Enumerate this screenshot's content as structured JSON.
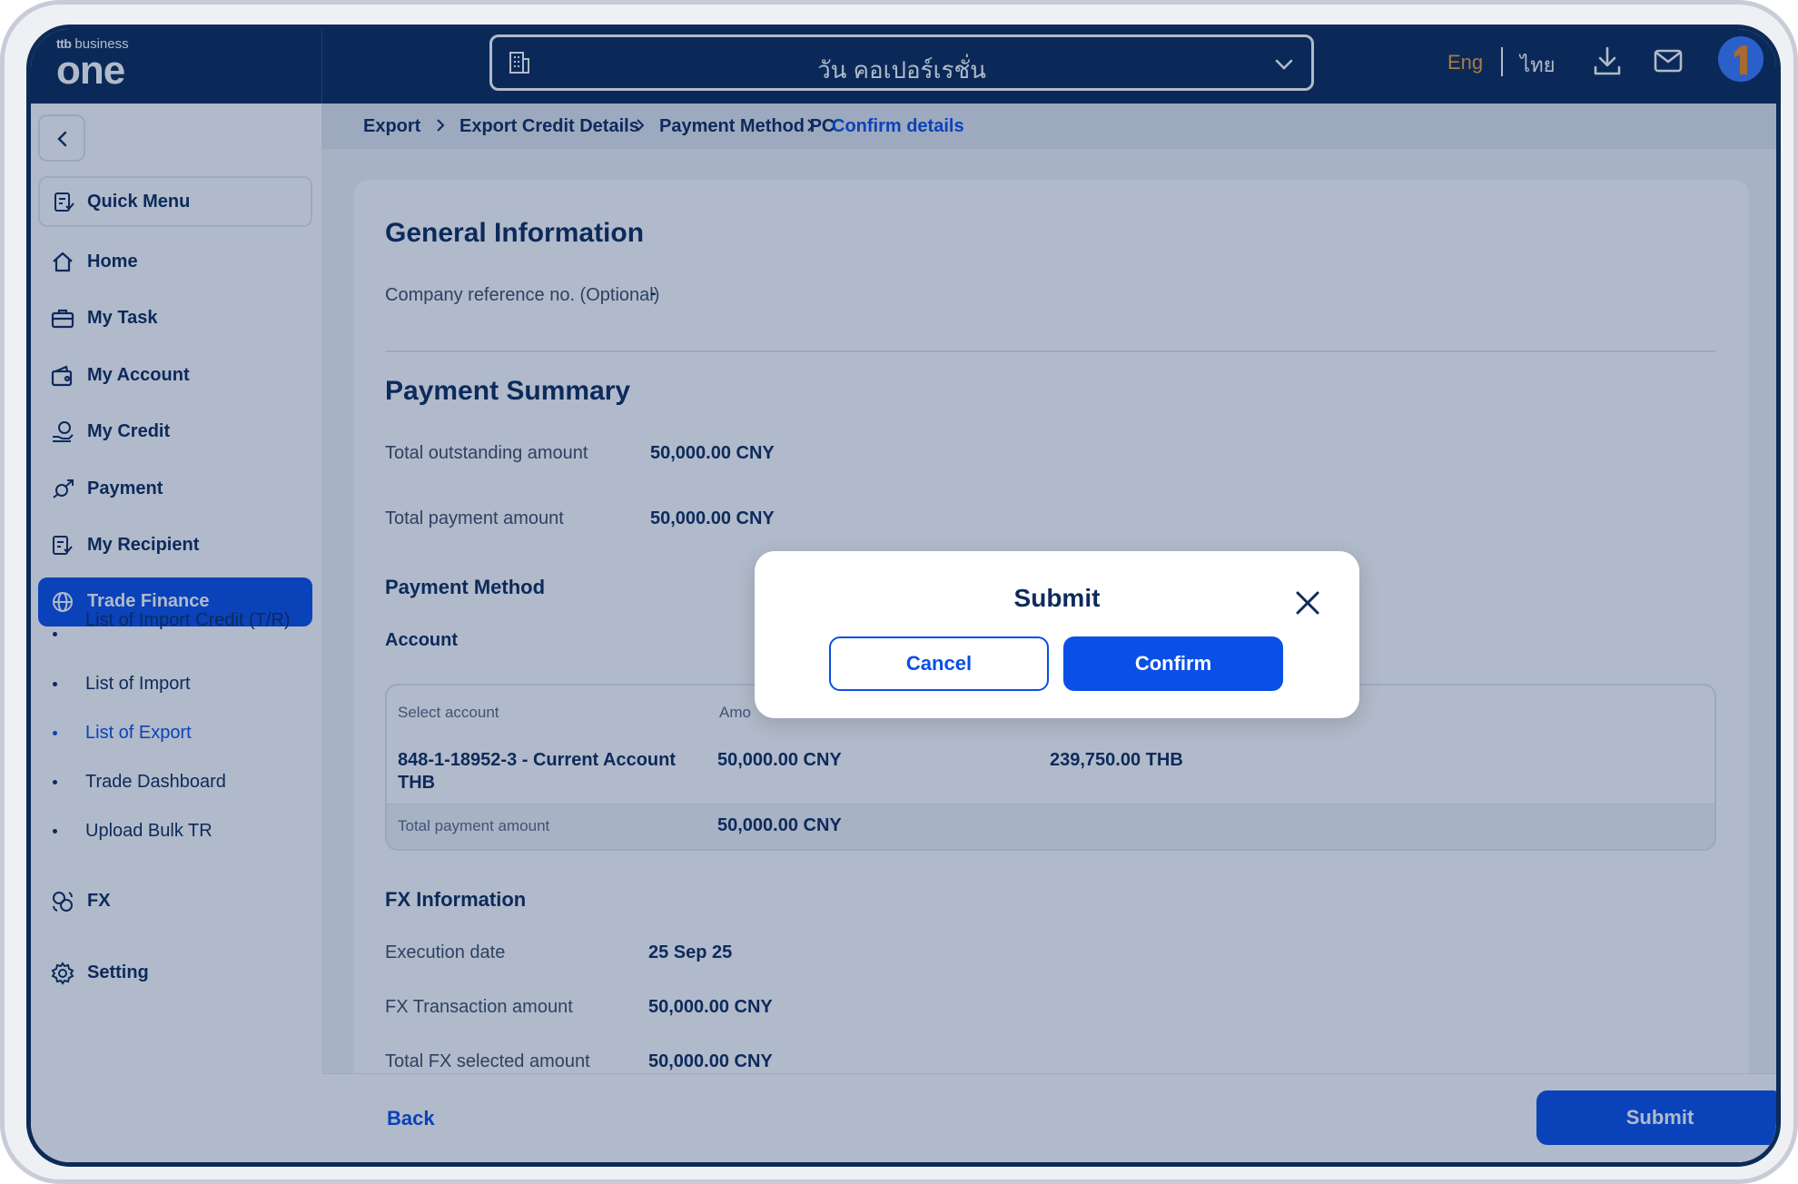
{
  "brand": {
    "prefix": "ttb",
    "suffix": "business",
    "wordmark": "one"
  },
  "header": {
    "company_name": "วัน คอเปอร์เรชั่น",
    "lang_eng": "Eng",
    "lang_th": "ไทย",
    "accent_color": "#f4a23c"
  },
  "sidebar": {
    "quick_menu": "Quick Menu",
    "items": [
      {
        "label": "Home",
        "icon": "home-icon"
      },
      {
        "label": "My Task",
        "icon": "briefcase-icon"
      },
      {
        "label": "My Account",
        "icon": "wallet-icon"
      },
      {
        "label": "My Credit",
        "icon": "credit-icon"
      },
      {
        "label": "Payment",
        "icon": "payment-icon"
      },
      {
        "label": "My Recipient",
        "icon": "recipient-icon"
      },
      {
        "label": "Trade Finance",
        "icon": "globe-icon",
        "active": true
      }
    ],
    "sub_items": [
      {
        "label": "List of Import Credit (T/R)"
      },
      {
        "label": "List of Import"
      },
      {
        "label": "List of Export",
        "current": true
      },
      {
        "label": "Trade Dashboard"
      },
      {
        "label": "Upload Bulk TR"
      }
    ],
    "bottom_items": [
      {
        "label": "FX",
        "icon": "fx-icon"
      },
      {
        "label": "Setting",
        "icon": "gear-icon"
      }
    ]
  },
  "breadcrumb": [
    "Export",
    "Export Credit Details",
    "Payment Method PC",
    "Confirm details"
  ],
  "general": {
    "title": "General Information",
    "ref_label": "Company reference no. (Optional)",
    "ref_value": "-"
  },
  "summary": {
    "title": "Payment Summary",
    "outstanding_label": "Total outstanding amount",
    "outstanding_value": "50,000.00 CNY",
    "payment_label": "Total payment amount",
    "payment_value": "50,000.00 CNY"
  },
  "method": {
    "title": "Payment Method",
    "account_title": "Account",
    "table": {
      "col_account": "Select account",
      "col_amount": "Amo",
      "row_account": "848-1-18952-3 - Current Account THB",
      "row_amount": "50,000.00 CNY",
      "row_thb": "239,750.00 THB",
      "total_label": "Total payment amount",
      "total_value": "50,000.00 CNY"
    }
  },
  "fx": {
    "title": "FX Information",
    "exec_label": "Execution date",
    "exec_value": "25 Sep 25",
    "txn_label": "FX Transaction amount",
    "txn_value": "50,000.00 CNY",
    "selected_label": "Total FX selected amount",
    "selected_value": "50,000.00 CNY"
  },
  "footer": {
    "back": "Back",
    "submit": "Submit"
  },
  "modal": {
    "title": "Submit",
    "cancel": "Cancel",
    "confirm": "Confirm"
  },
  "colors": {
    "navy": "#0b2a57",
    "primary": "#0a4fe6",
    "text": "#0d2b5c"
  }
}
